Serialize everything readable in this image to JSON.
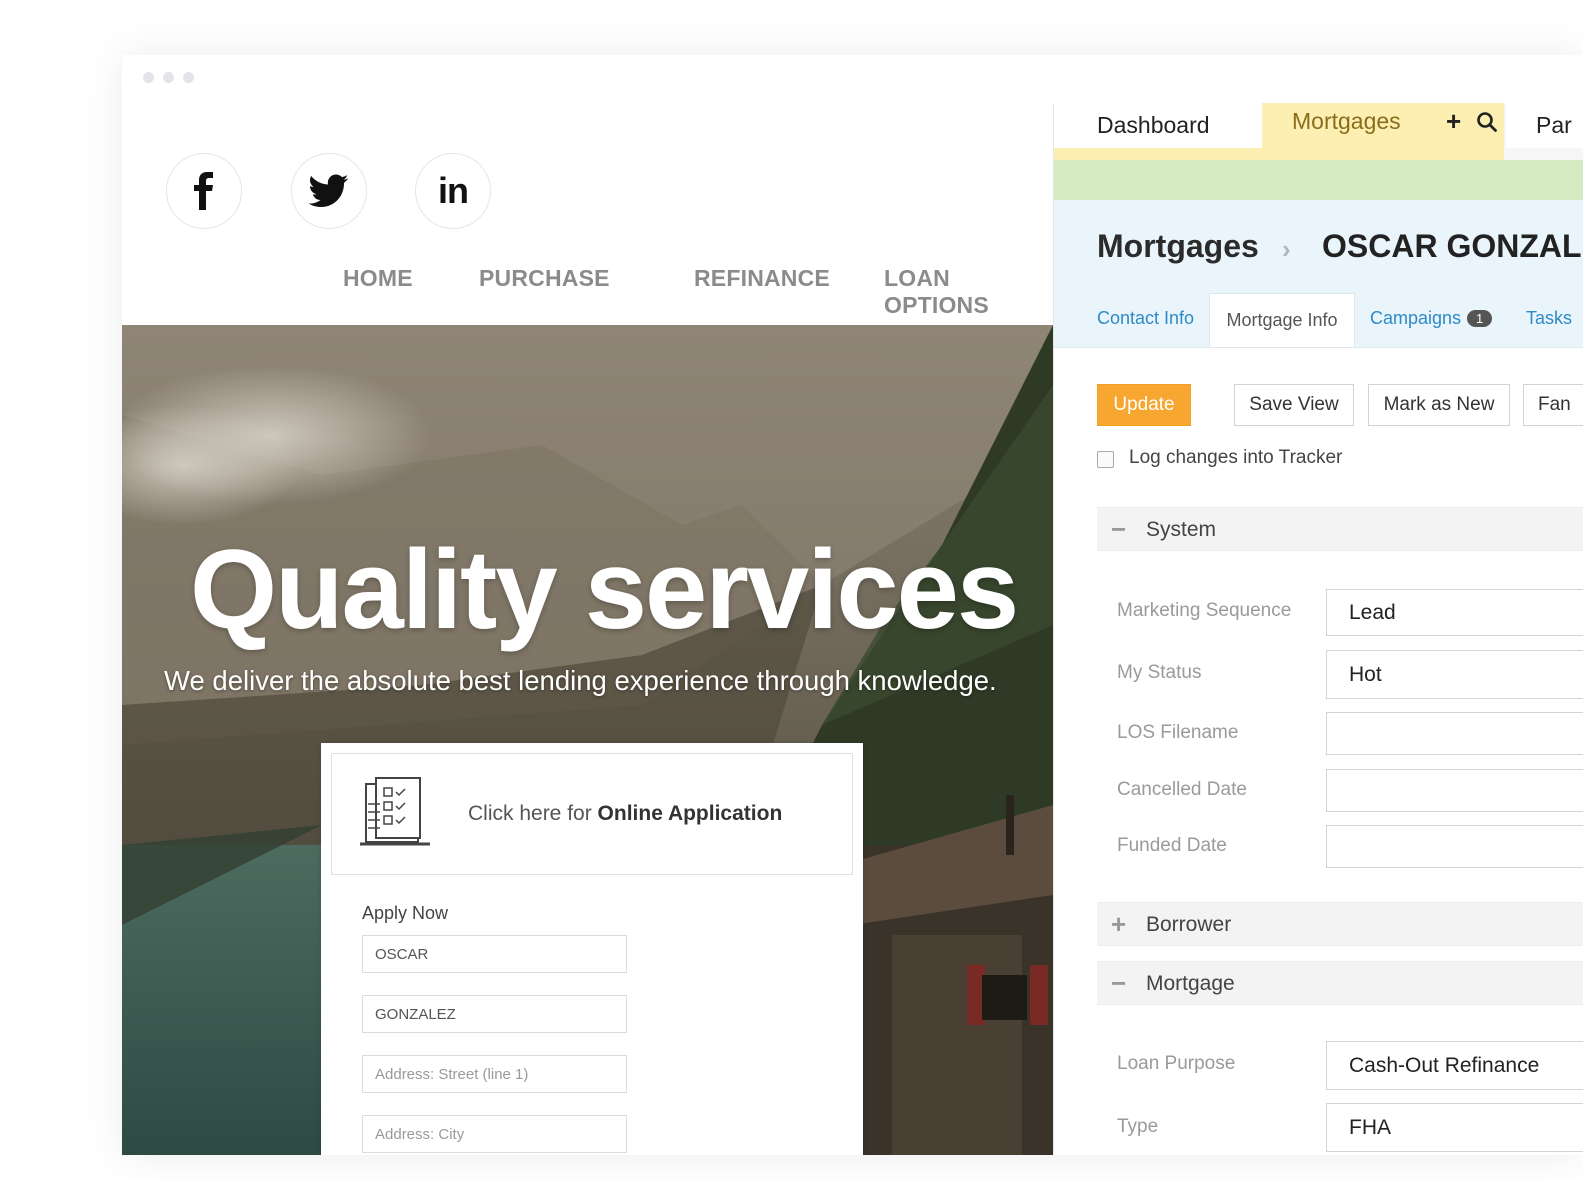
{
  "site": {
    "nav": [
      "HOME",
      "PURCHASE",
      "REFINANCE",
      "LOAN OPTIONS"
    ],
    "social_icons": [
      "facebook-icon",
      "twitter-icon",
      "linkedin-icon"
    ],
    "hero_title": "Quality services",
    "hero_subtitle": "We deliver the absolute best lending experience through knowledge.",
    "online_app": {
      "prefix": "Click here for ",
      "bold": "Online Application"
    },
    "apply": {
      "label": "Apply Now",
      "first_name": "OSCAR",
      "last_name": "GONZALEZ",
      "address_placeholder": "Address: Street (line 1)",
      "city_placeholder": "Address: City"
    }
  },
  "crm": {
    "tabs": {
      "dashboard": "Dashboard",
      "mortgages": "Mortgages",
      "partial": "Par"
    },
    "breadcrumb": {
      "section": "Mortgages",
      "record": "OSCAR GONZAL"
    },
    "subtabs": {
      "contact": "Contact Info",
      "mortgage": "Mortgage Info",
      "campaigns": "Campaigns",
      "campaigns_count": "1",
      "tasks": "Tasks"
    },
    "buttons": {
      "update": "Update",
      "save_view": "Save View",
      "mark_new": "Mark as New",
      "partial": "Fan"
    },
    "log_changes": "Log changes into Tracker",
    "sections": {
      "system": "System",
      "borrower": "Borrower",
      "mortgage": "Mortgage"
    },
    "system_fields": [
      {
        "label": "Marketing Sequence",
        "value": "Lead"
      },
      {
        "label": "My Status",
        "value": "Hot"
      },
      {
        "label": "LOS Filename",
        "value": ""
      },
      {
        "label": "Cancelled Date",
        "value": ""
      },
      {
        "label": "Funded Date",
        "value": ""
      }
    ],
    "mortgage_fields": [
      {
        "label": "Loan Purpose",
        "value": "Cash-Out Refinance"
      },
      {
        "label": "Type",
        "value": "FHA"
      }
    ]
  },
  "colors": {
    "accent": "#f7a72f",
    "link": "#2d8ac7",
    "tab_active": "#fcefb1",
    "green_bar": "#d7ebc3",
    "header_bg": "#e9f5fb"
  }
}
